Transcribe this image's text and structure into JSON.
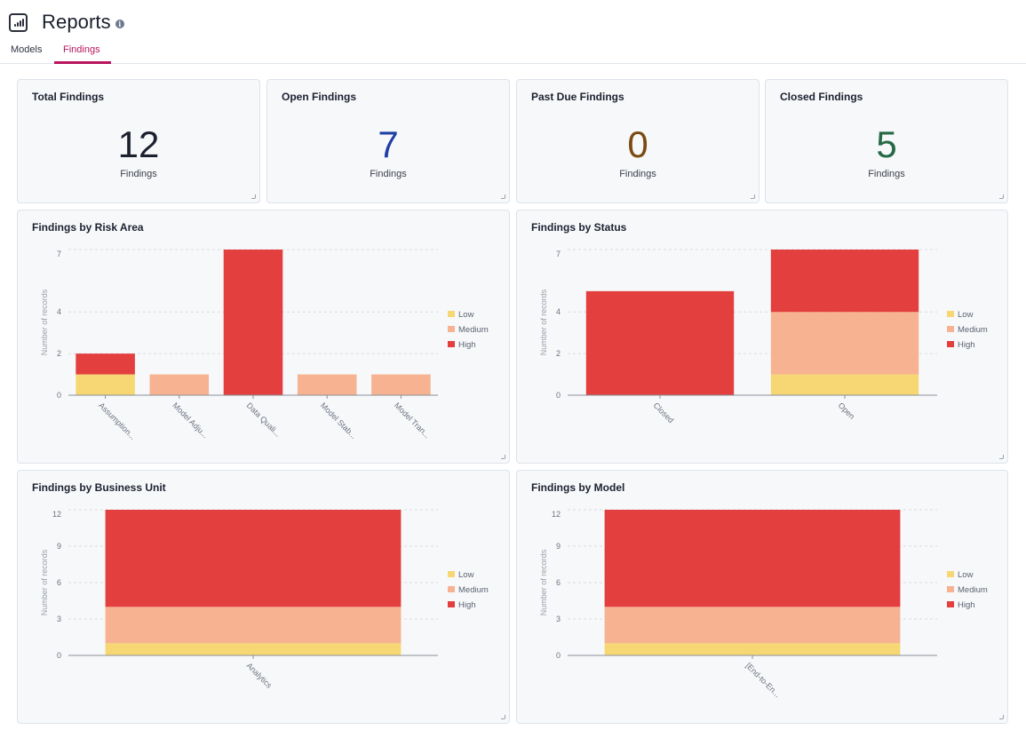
{
  "header": {
    "title": "Reports",
    "icon": "bar-chart-icon",
    "info_icon": "info-icon",
    "info_glyph": "i"
  },
  "tabs": [
    {
      "label": "Models",
      "active": false
    },
    {
      "label": "Findings",
      "active": true
    }
  ],
  "stats": [
    {
      "title": "Total Findings",
      "value": "12",
      "unit": "Findings",
      "color": "#1c2130"
    },
    {
      "title": "Open Findings",
      "value": "7",
      "unit": "Findings",
      "color": "#1f3fa6"
    },
    {
      "title": "Past Due Findings",
      "value": "0",
      "unit": "Findings",
      "color": "#7a4a12"
    },
    {
      "title": "Closed Findings",
      "value": "5",
      "unit": "Findings",
      "color": "#256a45"
    }
  ],
  "colors": {
    "Low": "#f7d774",
    "Medium": "#f7b291",
    "High": "#e33f3f"
  },
  "chart_data": [
    {
      "type": "bar",
      "stacked": true,
      "title": "Findings by Risk Area",
      "xlabel": "",
      "ylabel": "Number of records",
      "ylim": [
        0,
        7
      ],
      "yticks": [
        0,
        2,
        4,
        7
      ],
      "grid": true,
      "legend": "right",
      "categories": [
        "Assumption...",
        "Model Adju...",
        "Data Quali...",
        "Model Stab...",
        "Model Tran..."
      ],
      "series": [
        {
          "name": "Low",
          "values": [
            1,
            0,
            0,
            0,
            0
          ]
        },
        {
          "name": "Medium",
          "values": [
            0,
            1,
            0,
            1,
            1
          ]
        },
        {
          "name": "High",
          "values": [
            1,
            0,
            7,
            0,
            0
          ]
        }
      ]
    },
    {
      "type": "bar",
      "stacked": true,
      "title": "Findings by Status",
      "xlabel": "",
      "ylabel": "Number of records",
      "ylim": [
        0,
        7
      ],
      "yticks": [
        0,
        2,
        4,
        7
      ],
      "grid": true,
      "legend": "right",
      "categories": [
        "Closed",
        "Open"
      ],
      "series": [
        {
          "name": "Low",
          "values": [
            0,
            1
          ]
        },
        {
          "name": "Medium",
          "values": [
            0,
            3
          ]
        },
        {
          "name": "High",
          "values": [
            5,
            3
          ]
        }
      ]
    },
    {
      "type": "bar",
      "stacked": true,
      "title": "Findings by Business Unit",
      "xlabel": "",
      "ylabel": "Number of records",
      "ylim": [
        0,
        12
      ],
      "yticks": [
        0,
        3,
        6,
        9,
        12
      ],
      "grid": true,
      "legend": "right",
      "categories": [
        "Analytics"
      ],
      "series": [
        {
          "name": "Low",
          "values": [
            1
          ]
        },
        {
          "name": "Medium",
          "values": [
            3
          ]
        },
        {
          "name": "High",
          "values": [
            8
          ]
        }
      ]
    },
    {
      "type": "bar",
      "stacked": true,
      "title": "Findings by Model",
      "xlabel": "",
      "ylabel": "Number of records",
      "ylim": [
        0,
        12
      ],
      "yticks": [
        0,
        3,
        6,
        9,
        12
      ],
      "grid": true,
      "legend": "right",
      "categories": [
        "[End-to-En..."
      ],
      "series": [
        {
          "name": "Low",
          "values": [
            1
          ]
        },
        {
          "name": "Medium",
          "values": [
            3
          ]
        },
        {
          "name": "High",
          "values": [
            8
          ]
        }
      ]
    }
  ]
}
